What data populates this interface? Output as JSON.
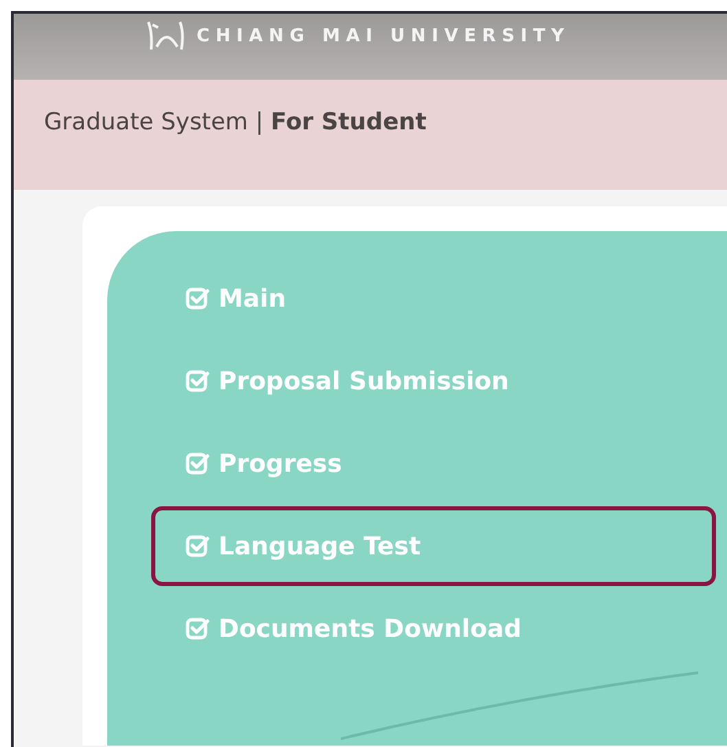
{
  "header": {
    "university": "CHIANG MAI UNIVERSITY"
  },
  "system_bar": {
    "title": "Graduate System | **For Student**"
  },
  "menu": {
    "items": [
      {
        "label": "Main",
        "checked": true,
        "selected": false
      },
      {
        "label": "Proposal Submission",
        "checked": true,
        "selected": false
      },
      {
        "label": "Progress",
        "checked": true,
        "selected": false
      },
      {
        "label": "Language Test",
        "checked": true,
        "selected": true
      },
      {
        "label": "Documents Download",
        "checked": true,
        "selected": false
      }
    ]
  }
}
